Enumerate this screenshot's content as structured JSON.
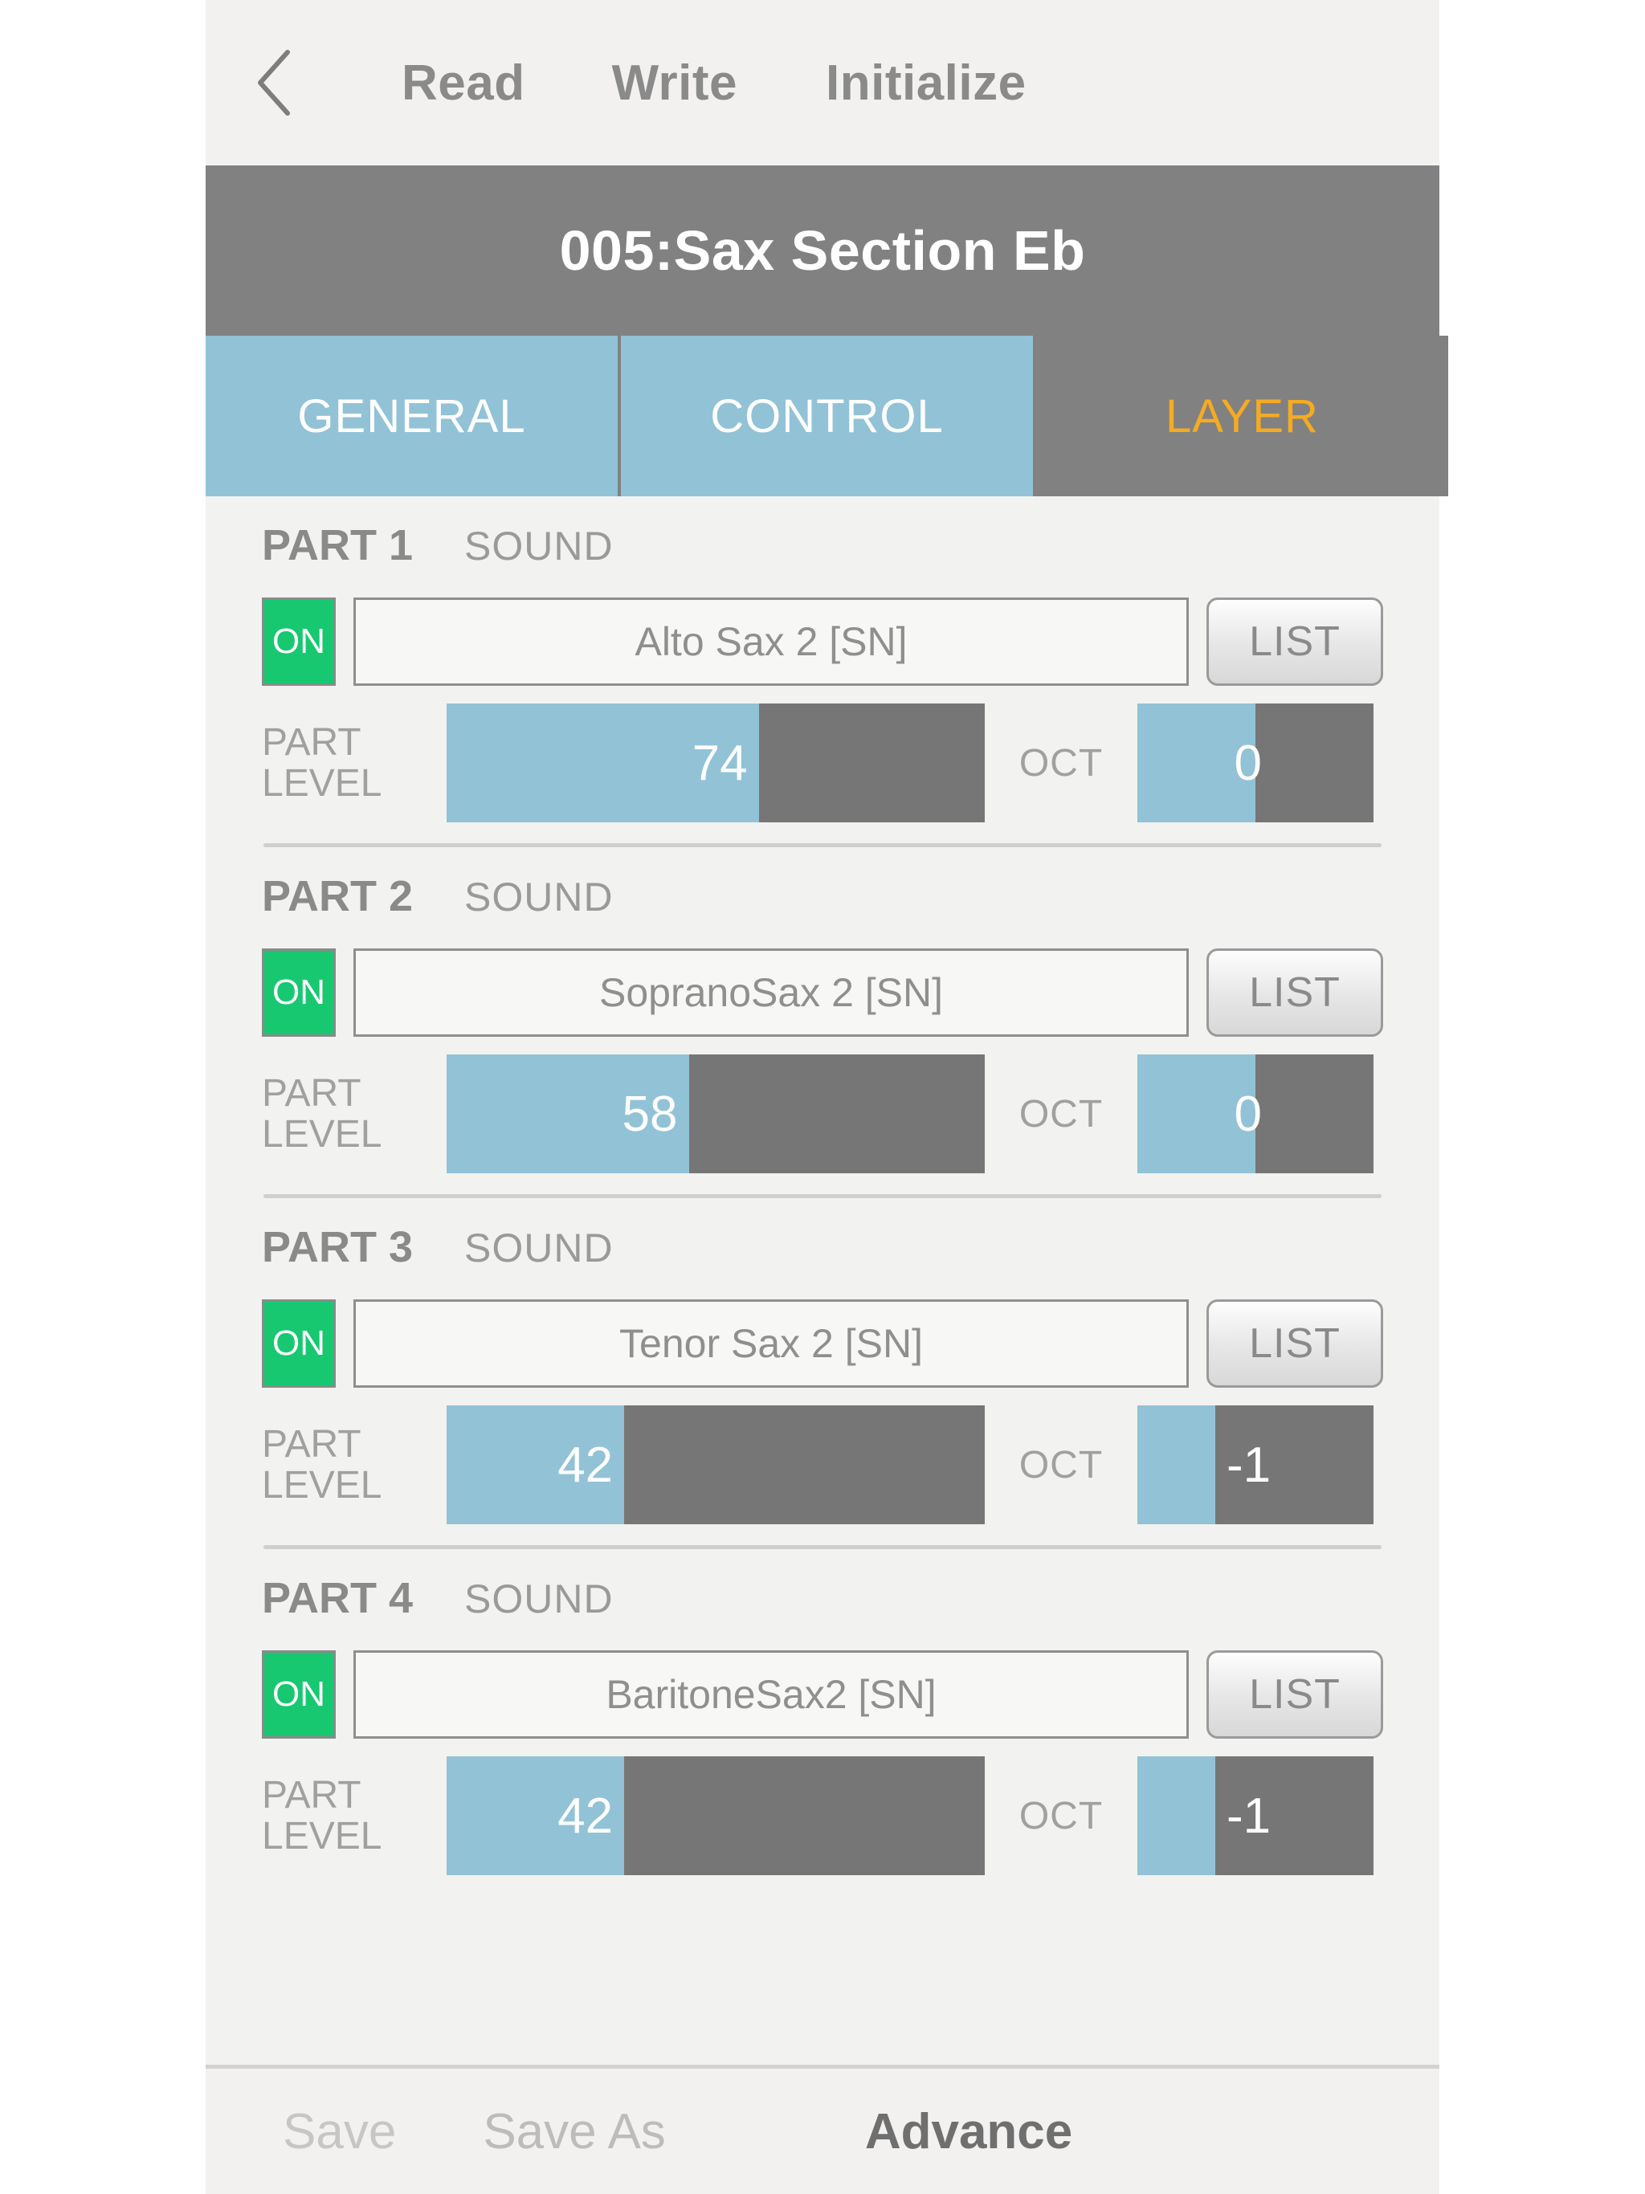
{
  "topnav": {
    "back_icon": "chevron-left-icon",
    "read_label": "Read",
    "write_label": "Write",
    "initialize_label": "Initialize"
  },
  "patch": {
    "title": "005:Sax Section Eb"
  },
  "tabs": [
    {
      "label": "GENERAL",
      "active": false
    },
    {
      "label": "CONTROL",
      "active": false
    },
    {
      "label": "LAYER",
      "active": true
    }
  ],
  "colors": {
    "tab_inactive_bg": "#92c2d6",
    "tab_active_text": "#f5ab21",
    "header_bg": "#818181",
    "on_green": "#17c871",
    "slider_fill": "#92c2d6",
    "slider_track": "#767676",
    "page_bg": "#f2f2f0"
  },
  "common": {
    "sound_label": "SOUND",
    "on_label": "ON",
    "list_label": "LIST",
    "level_label_line1": "PART",
    "level_label_line2": "LEVEL",
    "oct_label": "OCT"
  },
  "parts": [
    {
      "name": "PART 1",
      "sound": "Alto Sax 2 [SN]",
      "on": "ON",
      "list": "LIST",
      "level_value": "74",
      "level_fill_pct": 58,
      "oct_value": "0",
      "oct_fill_pct": 50
    },
    {
      "name": "PART 2",
      "sound": "SopranoSax 2 [SN]",
      "on": "ON",
      "list": "LIST",
      "level_value": "58",
      "level_fill_pct": 45,
      "oct_value": "0",
      "oct_fill_pct": 50
    },
    {
      "name": "PART 3",
      "sound": "Tenor Sax 2 [SN]",
      "on": "ON",
      "list": "LIST",
      "level_value": "42",
      "level_fill_pct": 33,
      "oct_value": "-1",
      "oct_fill_pct": 33
    },
    {
      "name": "PART 4",
      "sound": "BaritoneSax2 [SN]",
      "on": "ON",
      "list": "LIST",
      "level_value": "42",
      "level_fill_pct": 33,
      "oct_value": "-1",
      "oct_fill_pct": 33
    }
  ],
  "bottom": {
    "save_label": "Save",
    "save_as_label": "Save As",
    "advance_label": "Advance"
  }
}
